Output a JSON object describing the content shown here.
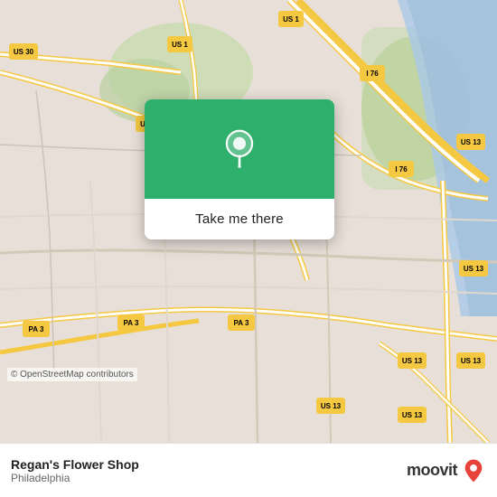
{
  "map": {
    "background_color": "#e8e0d8",
    "attribution": "© OpenStreetMap contributors"
  },
  "popup": {
    "button_label": "Take me there",
    "green_color": "#2eaf6b",
    "pin_icon": "location-pin-icon"
  },
  "bottom_bar": {
    "place_name": "Regan's Flower Shop",
    "place_city": "Philadelphia",
    "logo_text": "moovit"
  },
  "routes": {
    "highway_color": "#f5c842",
    "road_color": "#ffffff",
    "minor_road_color": "#d4c9b8"
  }
}
